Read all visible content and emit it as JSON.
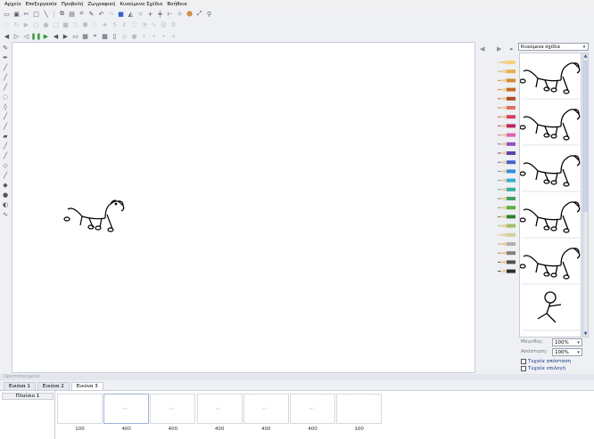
{
  "menu": [
    "Αρχείο",
    "Επεξεργασία",
    "Προβολή",
    "Ζωγραφική",
    "Κινούμενο Σχέδιο",
    "Βοήθεια"
  ],
  "panel": {
    "selector_value": "Κινούμενα σχέδια",
    "size_label": "Μέγεθος:",
    "size_value": "100%",
    "distance_label": "Απόσταση:",
    "distance_value": "100%",
    "random_distance_label": "Τυχαία απόσταση",
    "random_selection_label": "Τυχαία επιλογή"
  },
  "status_text": "Οριστοποιημένο",
  "tabs": [
    "Εικόνα 1",
    "Εικόνα 2",
    "Εικόνα 3"
  ],
  "active_tab": 2,
  "layer_name": "Πλαίσιο 1",
  "frame_delays": [
    "100",
    "400",
    "400",
    "400",
    "400",
    "400",
    "100"
  ],
  "colors": {
    "pencils": [
      "#f4d27a",
      "#e8b04a",
      "#d98a2e",
      "#c86a22",
      "#b04a1e",
      "#e27060",
      "#d84060",
      "#c02060",
      "#e060b0",
      "#9050c0",
      "#6040b0",
      "#4060d0",
      "#3090e0",
      "#30b0d0",
      "#30b0a0",
      "#40a060",
      "#60b040",
      "#308030",
      "#a0c060",
      "#d0d0a0",
      "#b0b0b0",
      "#808080",
      "#505050",
      "#303030"
    ]
  }
}
